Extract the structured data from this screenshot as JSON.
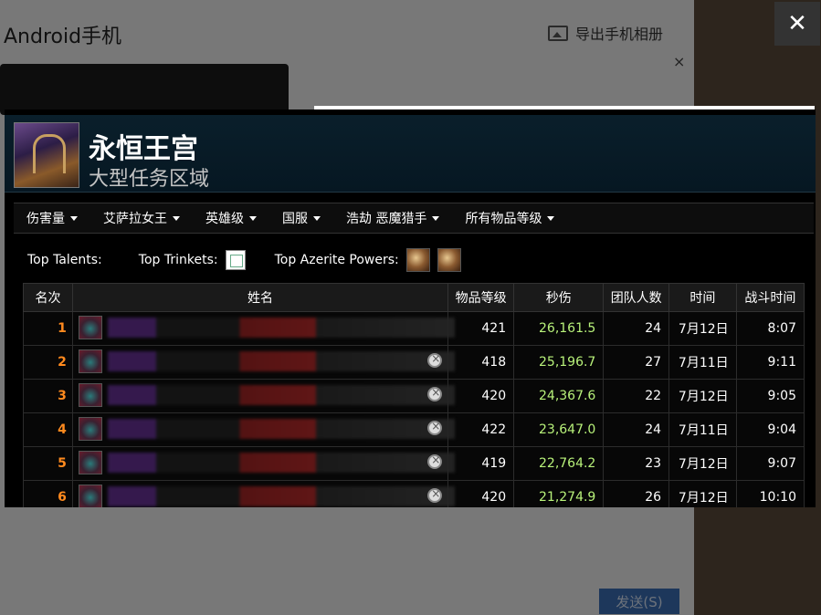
{
  "host": {
    "window_title": "Android手机",
    "export_label": "导出手机相册",
    "send_label": "发送(S)"
  },
  "popup": {
    "close_glyph": "✕",
    "zone": {
      "title": "永恒王宫",
      "subtitle": "大型任务区域"
    },
    "filters": [
      "伤害量",
      "艾萨拉女王",
      "英雄级",
      "国服",
      "浩劫 恶魔猎手",
      "所有物品等级"
    ],
    "top": {
      "talents_label": "Top Talents:",
      "trinkets_label": "Top Trinkets:",
      "azerite_label": "Top Azerite Powers:"
    },
    "table": {
      "headers": [
        "名次",
        "姓名",
        "物品等级",
        "秒伤",
        "团队人数",
        "时间",
        "战斗时间"
      ],
      "rows": [
        {
          "rank": "1",
          "ilvl": "421",
          "dps": "26,161.5",
          "raid_size": "24",
          "date": "7月12日",
          "duration": "8:07"
        },
        {
          "rank": "2",
          "ilvl": "418",
          "dps": "25,196.7",
          "raid_size": "27",
          "date": "7月11日",
          "duration": "9:11"
        },
        {
          "rank": "3",
          "ilvl": "420",
          "dps": "24,367.6",
          "raid_size": "22",
          "date": "7月12日",
          "duration": "9:05"
        },
        {
          "rank": "4",
          "ilvl": "422",
          "dps": "23,647.0",
          "raid_size": "24",
          "date": "7月11日",
          "duration": "9:04"
        },
        {
          "rank": "5",
          "ilvl": "419",
          "dps": "22,764.2",
          "raid_size": "23",
          "date": "7月12日",
          "duration": "9:07"
        },
        {
          "rank": "6",
          "ilvl": "420",
          "dps": "21,274.9",
          "raid_size": "26",
          "date": "7月12日",
          "duration": "10:10"
        }
      ]
    }
  }
}
